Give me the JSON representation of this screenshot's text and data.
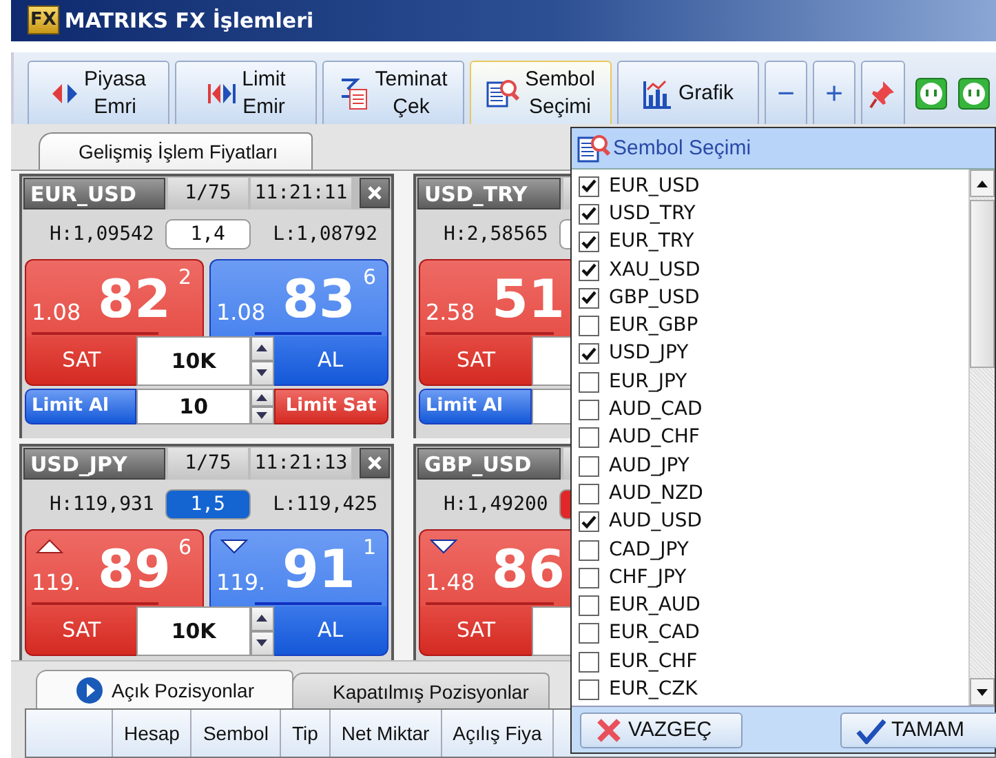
{
  "window": {
    "logo": "FX",
    "title": "MATRIKS FX İşlemleri"
  },
  "toolbar": [
    {
      "kind": "labeled",
      "lines": [
        "Piyasa",
        "Emri"
      ],
      "selected": false
    },
    {
      "kind": "labeled",
      "lines": [
        "Limit",
        "Emir"
      ],
      "selected": false
    },
    {
      "kind": "labeled",
      "lines": [
        "Teminat",
        "Çek"
      ],
      "selected": false
    },
    {
      "kind": "labeled",
      "lines": [
        "Sembol",
        "Seçimi"
      ],
      "selected": true
    },
    {
      "kind": "labeled",
      "lines": [
        "Grafik"
      ],
      "selected": false
    },
    {
      "kind": "symbol",
      "text": "−",
      "selected": false
    },
    {
      "kind": "symbol",
      "text": "+",
      "selected": false
    },
    {
      "kind": "icon",
      "selected": false
    },
    {
      "kind": "icon",
      "selected": false
    },
    {
      "kind": "icon",
      "selected": false
    }
  ],
  "main_tab": {
    "label": "Gelişmiş İşlem Fiyatları",
    "selected": true
  },
  "cards": [
    {
      "symbol": "EUR_USD",
      "counter": "1/75",
      "time": "11:21:11",
      "high": "H:1,09542",
      "spread": {
        "value": "1,4",
        "color": "#ffffff"
      },
      "low": "L:1,08792",
      "sell": {
        "prefix": "1.08",
        "big": "82",
        "pip": "2",
        "label": "SAT",
        "rising": false,
        "falling": false
      },
      "buy": {
        "prefix": "1.08",
        "big": "83",
        "pip": "6",
        "label": "AL",
        "rising": false,
        "falling": false
      },
      "quantity": "10K",
      "limit": {
        "buy": "Limit Al",
        "value": "10",
        "sell": "Limit Sat"
      }
    },
    {
      "symbol": "USD_TRY",
      "high": "H:2,58565",
      "spread": {
        "color": "#ffffff"
      },
      "sell": {
        "prefix": "2.58",
        "big": "51",
        "label": "SAT",
        "rising": false,
        "falling": false
      },
      "limit": {
        "buy": "Limit Al"
      }
    },
    {
      "symbol": "USD_JPY",
      "counter": "1/75",
      "time": "11:21:13",
      "high": "H:119,931",
      "spread": {
        "value": "1,5",
        "color": "#1464d2"
      },
      "low": "L:119,425",
      "sell": {
        "prefix": "119.",
        "big": "89",
        "pip": "6",
        "label": "SAT",
        "rising": true,
        "falling": false
      },
      "buy": {
        "prefix": "119.",
        "big": "91",
        "pip": "1",
        "label": "AL",
        "rising": false,
        "falling": true
      },
      "quantity": "10K"
    },
    {
      "symbol": "GBP_USD",
      "high": "H:1,49200",
      "spread": {
        "color": "#e02828"
      },
      "sell": {
        "prefix": "1.48",
        "big": "86",
        "label": "SAT",
        "rising": false,
        "falling": true
      }
    }
  ],
  "bottom_tabs": [
    {
      "label": "Açık Pozisyonlar",
      "selected": true
    },
    {
      "label": "Kapatılmış Pozisyonlar",
      "selected": false
    }
  ],
  "table": {
    "columns": [
      "Hesap",
      "Sembol",
      "Tip",
      "Net Miktar",
      "Açılış Fiya"
    ]
  },
  "symbol_picker": {
    "title": "Sembol Seçimi",
    "symbols": [
      {
        "label": "EUR_USD",
        "checked": true
      },
      {
        "label": "USD_TRY",
        "checked": true
      },
      {
        "label": "EUR_TRY",
        "checked": true
      },
      {
        "label": "XAU_USD",
        "checked": true
      },
      {
        "label": "GBP_USD",
        "checked": true
      },
      {
        "label": "EUR_GBP",
        "checked": false
      },
      {
        "label": "USD_JPY",
        "checked": true
      },
      {
        "label": "EUR_JPY",
        "checked": false
      },
      {
        "label": "AUD_CAD",
        "checked": false
      },
      {
        "label": "AUD_CHF",
        "checked": false
      },
      {
        "label": "AUD_JPY",
        "checked": false
      },
      {
        "label": "AUD_NZD",
        "checked": false
      },
      {
        "label": "AUD_USD",
        "checked": true
      },
      {
        "label": "CAD_JPY",
        "checked": false
      },
      {
        "label": "CHF_JPY",
        "checked": false
      },
      {
        "label": "EUR_AUD",
        "checked": false
      },
      {
        "label": "EUR_CAD",
        "checked": false
      },
      {
        "label": "EUR_CHF",
        "checked": false
      },
      {
        "label": "EUR_CZK",
        "checked": false
      }
    ],
    "cancel": "VAZGEÇ",
    "ok": "TAMAM"
  }
}
